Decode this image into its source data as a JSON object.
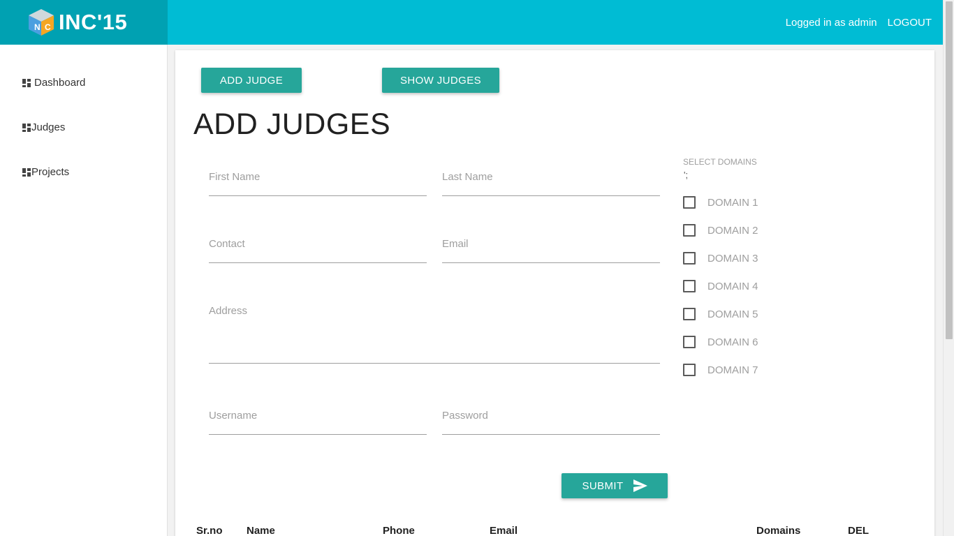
{
  "brand": {
    "name": "INC'15",
    "cube_letters": [
      "N",
      "C"
    ]
  },
  "topnav": {
    "logged_in": "Logged in as admin",
    "logout": "LOGOUT"
  },
  "sidebar": {
    "items": [
      {
        "label": "Dashboard",
        "icon": "dashboard-grid-icon"
      },
      {
        "label": "Judges",
        "icon": "dashboard-grid-icon"
      },
      {
        "label": "Projects",
        "icon": "dashboard-grid-icon"
      }
    ]
  },
  "toolbar": {
    "add_judge": "ADD JUDGE",
    "show_judges": "SHOW JUDGES"
  },
  "form": {
    "title": "ADD JUDGES",
    "first_name": {
      "placeholder": "First Name",
      "value": ""
    },
    "last_name": {
      "placeholder": "Last Name",
      "value": ""
    },
    "contact": {
      "placeholder": "Contact",
      "value": ""
    },
    "email": {
      "placeholder": "Email",
      "value": ""
    },
    "address": {
      "placeholder": "Address",
      "value": ""
    },
    "username": {
      "placeholder": "Username",
      "value": ""
    },
    "password": {
      "placeholder": "Password",
      "value": ""
    },
    "submit": "SUBMIT",
    "submit_icon": "send-icon"
  },
  "domains": {
    "label": "SELECT DOMAINS",
    "stray_text": "';",
    "items": [
      "DOMAIN 1",
      "DOMAIN 2",
      "DOMAIN 3",
      "DOMAIN 4",
      "DOMAIN 5",
      "DOMAIN 6",
      "DOMAIN 7"
    ]
  },
  "table": {
    "headers": [
      "Sr.no",
      "Name",
      "Phone",
      "Email",
      "Domains",
      "DEL"
    ]
  },
  "colors": {
    "topbar": "#00bcd4",
    "brand_bg": "#00a1b2",
    "button": "#26a69a",
    "sidebar_bg": "#ffffff"
  }
}
